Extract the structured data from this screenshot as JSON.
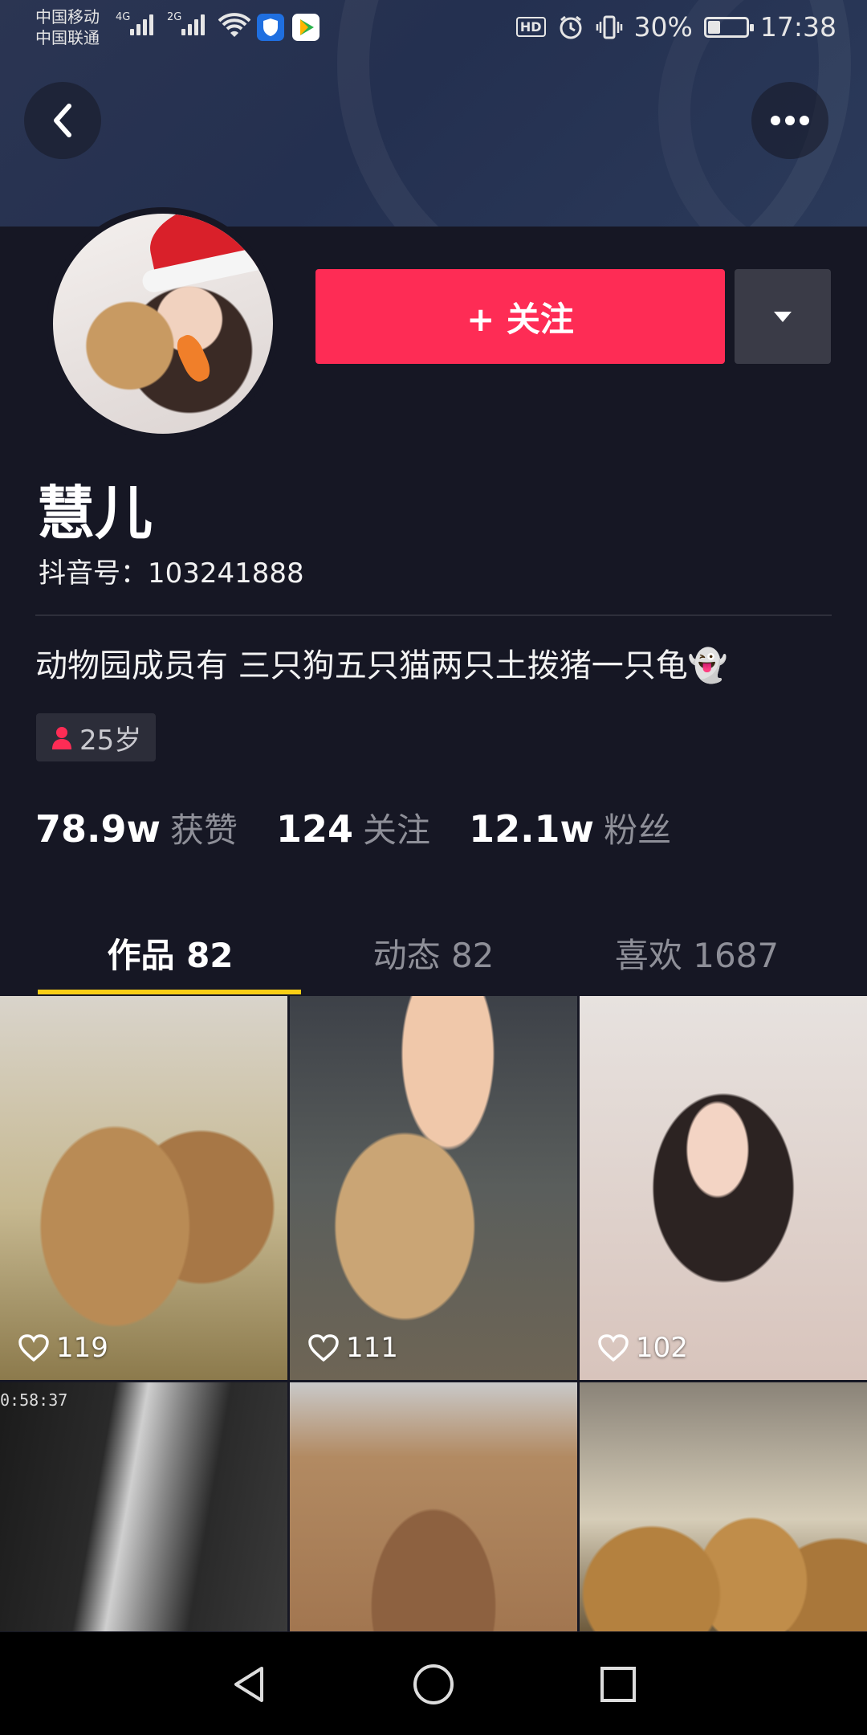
{
  "status_bar": {
    "carrier1": "中国移动",
    "carrier2": "中国联通",
    "net1": "4G",
    "net2": "2G",
    "hd": "HD",
    "battery": "30%",
    "battery_level": 0.3,
    "time": "17:38"
  },
  "profile": {
    "follow_label": "+ 关注",
    "nickname": "慧儿",
    "douyin_id": "抖音号：103241888",
    "bio": "动物园成员有 三只狗五只猫两只土拨猪一只龟👻",
    "age": "25岁",
    "stats": [
      {
        "value": "78.9w",
        "label": "获赞"
      },
      {
        "value": "124",
        "label": "关注"
      },
      {
        "value": "12.1w",
        "label": "粉丝"
      }
    ]
  },
  "tabs": [
    {
      "label": "作品 82",
      "active": true
    },
    {
      "label": "动态 82",
      "active": false
    },
    {
      "label": "喜欢 1687",
      "active": false
    }
  ],
  "videos": [
    {
      "likes": "119"
    },
    {
      "likes": "111"
    },
    {
      "likes": "102"
    },
    {
      "likes": "",
      "timestamp": "0:58:37"
    },
    {
      "likes": ""
    },
    {
      "likes": ""
    }
  ],
  "colors": {
    "accent": "#fe2c55",
    "tab_indicator": "#face15",
    "background": "#161724"
  },
  "icons": {
    "back": "back-arrow-icon",
    "more": "more-dots-icon",
    "dropdown": "triangle-down-icon",
    "like": "heart-outline-icon",
    "gender": "person-female-icon",
    "nav_back": "triangle-back-icon",
    "nav_home": "circle-home-icon",
    "nav_recent": "square-recent-icon"
  }
}
